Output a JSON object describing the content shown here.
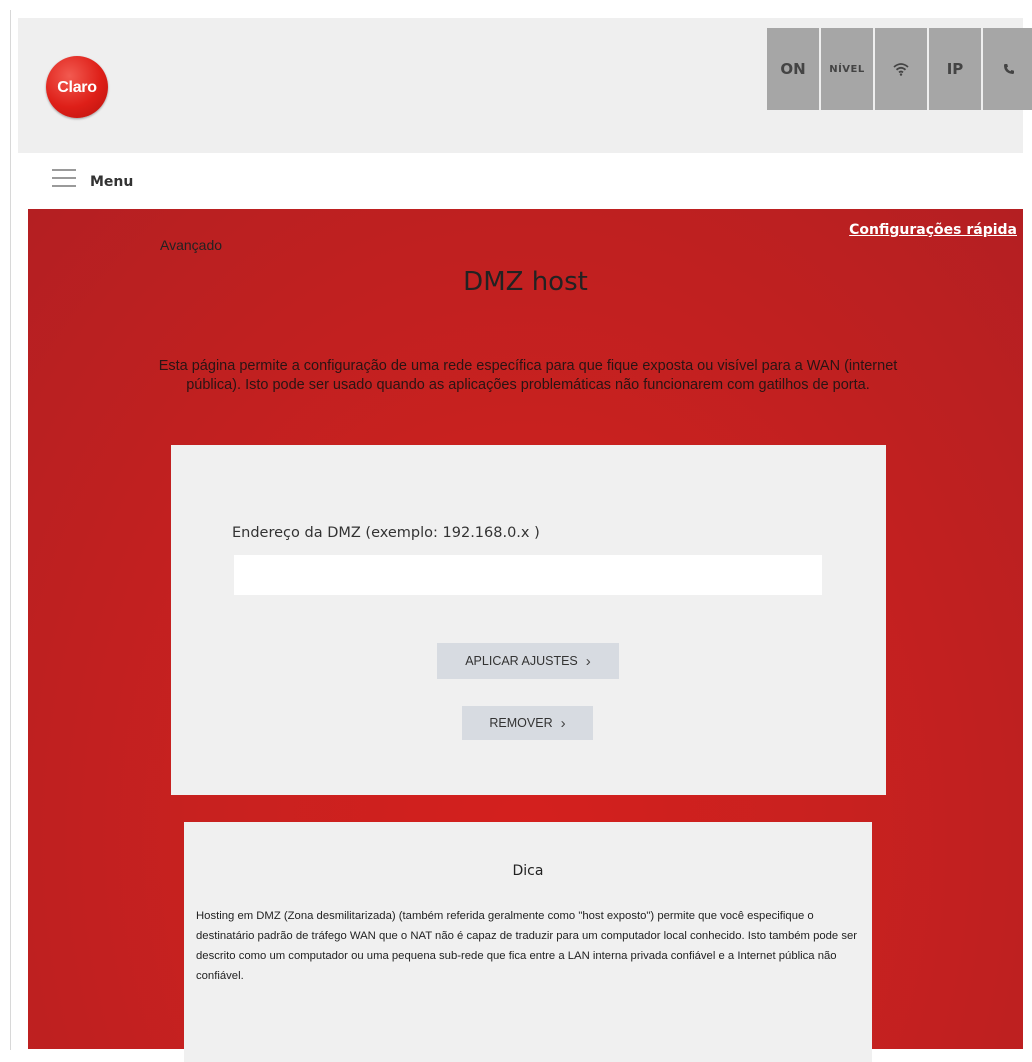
{
  "header": {
    "logo_text": "Claro",
    "status_items": [
      {
        "label": "ON",
        "icon": null
      },
      {
        "label": "NÍVEL",
        "icon": null
      },
      {
        "label": "",
        "icon": "wifi-icon"
      },
      {
        "label": "IP",
        "icon": null
      },
      {
        "label": "",
        "icon": "phone-icon"
      }
    ]
  },
  "menubar": {
    "menu_label": "Menu"
  },
  "main": {
    "breadcrumb": "Avançado",
    "quick_link": "Configurações rápida",
    "title": "DMZ host",
    "description": "Esta página permite a configuração de uma rede específica para que fique exposta ou visível para a WAN (internet pública). Isto pode ser usado quando as aplicações problemáticas não funcionarem com gatilhos de porta."
  },
  "form": {
    "field_label": "Endereço da DMZ (exemplo: 192.168.0.x )",
    "input_value": "",
    "apply_label": "APLICAR AJUSTES",
    "remove_label": "REMOVER"
  },
  "tip": {
    "title": "Dica",
    "text": "Hosting em DMZ (Zona desmilitarizada) (também referida geralmente como \"host exposto\") permite que você especifique o destinatário padrão de tráfego WAN que o NAT não é capaz de traduzir para um computador local conhecido. Isto também pode ser descrito como um computador ou uma pequena sub-rede que fica entre a LAN interna privada confiável e a Internet pública não confiável."
  },
  "colors": {
    "brand_red": "#c8211f",
    "status_gray": "#a6a6a6",
    "card_gray": "#f0f0f0",
    "button_gray": "#d7dbe1"
  }
}
